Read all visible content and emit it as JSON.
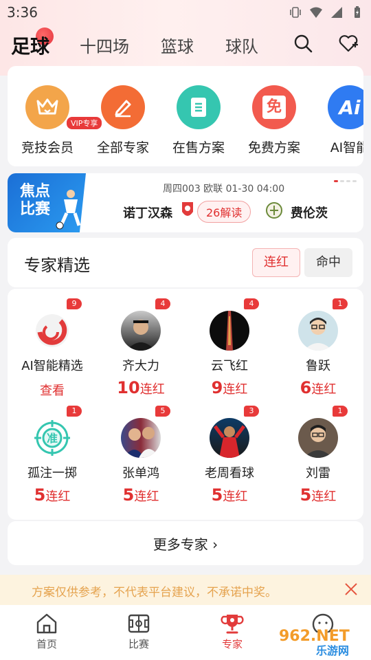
{
  "status": {
    "time": "3:36"
  },
  "top_tabs": [
    "足球",
    "十四场",
    "篮球",
    "球队"
  ],
  "categories": [
    {
      "label": "竞技会员",
      "badge": "VIP专享",
      "color": "#f3a54a",
      "icon": "crown-icon"
    },
    {
      "label": "全部专家",
      "color": "#f36c35",
      "icon": "pen-icon"
    },
    {
      "label": "在售方案",
      "color": "#35c6b0",
      "icon": "doc-icon"
    },
    {
      "label": "免费方案",
      "color": "#f25a4e",
      "icon": "free-ticket-icon",
      "icon_text": "免"
    },
    {
      "label": "AI智能",
      "color": "#2f7bf2",
      "icon": "ai-icon",
      "icon_text": "Ai"
    }
  ],
  "focus": {
    "banner": [
      "焦点",
      "比赛"
    ],
    "meta": "周四003 欧联 01-30 04:00",
    "team_home": "诺丁汉森",
    "team_away": "费伦茨",
    "reads": "26解读"
  },
  "experts_section": {
    "title": "专家精选",
    "tab_active": "连红",
    "tab_inactive": "命中"
  },
  "experts": [
    {
      "name": "AI智能精选",
      "count": "9",
      "action": "查看"
    },
    {
      "name": "齐大力",
      "count": "4",
      "streak": "10",
      "unit": "连红"
    },
    {
      "name": "云飞红",
      "count": "4",
      "streak": "9",
      "unit": "连红"
    },
    {
      "name": "鲁跃",
      "count": "1",
      "streak": "6",
      "unit": "连红"
    },
    {
      "name": "孤注一掷",
      "count": "1",
      "streak": "5",
      "unit": "连红",
      "avatar_text": "准"
    },
    {
      "name": "张单鸿",
      "count": "5",
      "streak": "5",
      "unit": "连红"
    },
    {
      "name": "老周看球",
      "count": "3",
      "streak": "5",
      "unit": "连红"
    },
    {
      "name": "刘雷",
      "count": "1",
      "streak": "5",
      "unit": "连红"
    }
  ],
  "more_experts": "更多专家 ›",
  "notice": "方案仅供参考，不代表平台建议，不承诺中奖。",
  "bottom_nav": [
    "首页",
    "比赛",
    "专家"
  ],
  "watermark": {
    "top": "962.NET",
    "bottom": "乐游网"
  },
  "colors": {
    "accent": "#e23b3b",
    "notice_text": "#e5a34f"
  }
}
